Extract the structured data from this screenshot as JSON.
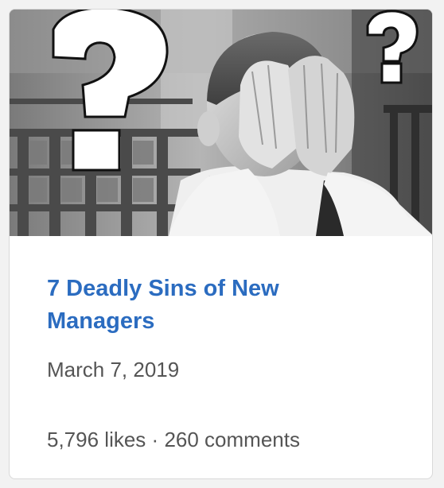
{
  "card": {
    "image": {
      "alt_icon": "facepalm-photo",
      "overlay_icon_left": "question-mark-icon",
      "overlay_icon_right": "question-mark-icon"
    },
    "title": "7 Deadly Sins of New Managers",
    "date": "March 7, 2019",
    "likes": "5,796 likes",
    "separator": "·",
    "comments": "260 comments"
  },
  "colors": {
    "title": "#2b6cc0",
    "meta": "#555555"
  }
}
